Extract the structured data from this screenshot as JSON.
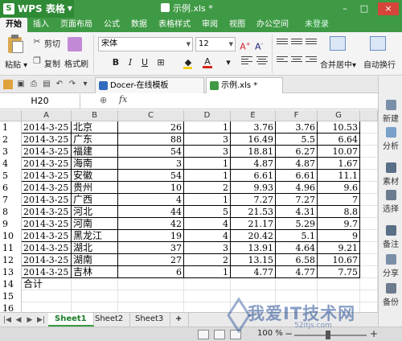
{
  "titlebar": {
    "app_name": "WPS 表格",
    "logo_char": "S",
    "doc_title": "示例.xls *",
    "minimize": "–",
    "maximize": "□",
    "close": "×"
  },
  "menu": {
    "tabs": [
      "开始",
      "插入",
      "页面布局",
      "公式",
      "数据",
      "表格样式",
      "审阅",
      "视图",
      "办公空间"
    ],
    "login": "未登录"
  },
  "ribbon": {
    "paste": "粘贴",
    "cut": "剪切",
    "copy": "复制",
    "format_painter": "格式刷",
    "font_name": "宋体",
    "font_size": "12",
    "bold": "B",
    "italic": "I",
    "underline": "U",
    "merge_center": "合并居中",
    "auto_wrap": "自动换行"
  },
  "doc_tabs": {
    "template_tab": "Docer-在线模板",
    "file_tab": "示例.xls *"
  },
  "formula_bar": {
    "cell_ref": "H20",
    "fx": "fx",
    "zoom_icon": "⊕"
  },
  "sheet": {
    "columns": [
      "A",
      "B",
      "C",
      "D",
      "E",
      "F",
      "G"
    ],
    "rows": [
      {
        "n": "1",
        "a": "2014-3-25",
        "b": "北京",
        "c": "26",
        "d": "1",
        "e": "3.76",
        "f": "3.76",
        "g": "10.53"
      },
      {
        "n": "2",
        "a": "2014-3-25",
        "b": "广东",
        "c": "88",
        "d": "3",
        "e": "16.49",
        "f": "5.5",
        "g": "6.64"
      },
      {
        "n": "3",
        "a": "2014-3-25",
        "b": "福建",
        "c": "54",
        "d": "3",
        "e": "18.81",
        "f": "6.27",
        "g": "10.07"
      },
      {
        "n": "4",
        "a": "2014-3-25",
        "b": "海南",
        "c": "3",
        "d": "1",
        "e": "4.87",
        "f": "4.87",
        "g": "1.67"
      },
      {
        "n": "5",
        "a": "2014-3-25",
        "b": "安徽",
        "c": "54",
        "d": "1",
        "e": "6.61",
        "f": "6.61",
        "g": "11.1"
      },
      {
        "n": "6",
        "a": "2014-3-25",
        "b": "贵州",
        "c": "10",
        "d": "2",
        "e": "9.93",
        "f": "4.96",
        "g": "9.6"
      },
      {
        "n": "7",
        "a": "2014-3-25",
        "b": "广西",
        "c": "4",
        "d": "1",
        "e": "7.27",
        "f": "7.27",
        "g": "7"
      },
      {
        "n": "8",
        "a": "2014-3-25",
        "b": "河北",
        "c": "44",
        "d": "5",
        "e": "21.53",
        "f": "4.31",
        "g": "8.8"
      },
      {
        "n": "9",
        "a": "2014-3-25",
        "b": "河南",
        "c": "42",
        "d": "4",
        "e": "21.17",
        "f": "5.29",
        "g": "9.7"
      },
      {
        "n": "10",
        "a": "2014-3-25",
        "b": "黑龙江",
        "c": "19",
        "d": "4",
        "e": "20.42",
        "f": "5.1",
        "g": "9"
      },
      {
        "n": "11",
        "a": "2014-3-25",
        "b": "湖北",
        "c": "37",
        "d": "3",
        "e": "13.91",
        "f": "4.64",
        "g": "9.21"
      },
      {
        "n": "12",
        "a": "2014-3-25",
        "b": "湖南",
        "c": "27",
        "d": "2",
        "e": "13.15",
        "f": "6.58",
        "g": "10.67"
      },
      {
        "n": "13",
        "a": "2014-3-25",
        "b": "吉林",
        "c": "6",
        "d": "1",
        "e": "4.77",
        "f": "4.77",
        "g": "7.75"
      },
      {
        "n": "14",
        "a": "合计",
        "b": "",
        "c": "",
        "d": "",
        "e": "",
        "f": "",
        "g": ""
      },
      {
        "n": "15",
        "a": "",
        "b": "",
        "c": "",
        "d": "",
        "e": "",
        "f": "",
        "g": ""
      },
      {
        "n": "16",
        "a": "",
        "b": "",
        "c": "",
        "d": "",
        "e": "",
        "f": "",
        "g": ""
      }
    ]
  },
  "sheet_tabs": [
    "Sheet1",
    "Sheet2",
    "Sheet3"
  ],
  "sheet_tab_add": "+",
  "status": {
    "zoom": "100 %",
    "minus": "−",
    "plus": "+"
  },
  "right_panel": [
    "新建",
    "分析",
    "素材",
    "选择",
    "备注",
    "分享",
    "备份"
  ],
  "watermark": {
    "main": "我爱IT技术网",
    "sub": "52itjs.com"
  },
  "colors": {
    "accent_green": "#3f9a45",
    "selected_sheet": "#1a7c26",
    "close_red": "#d6443a"
  }
}
